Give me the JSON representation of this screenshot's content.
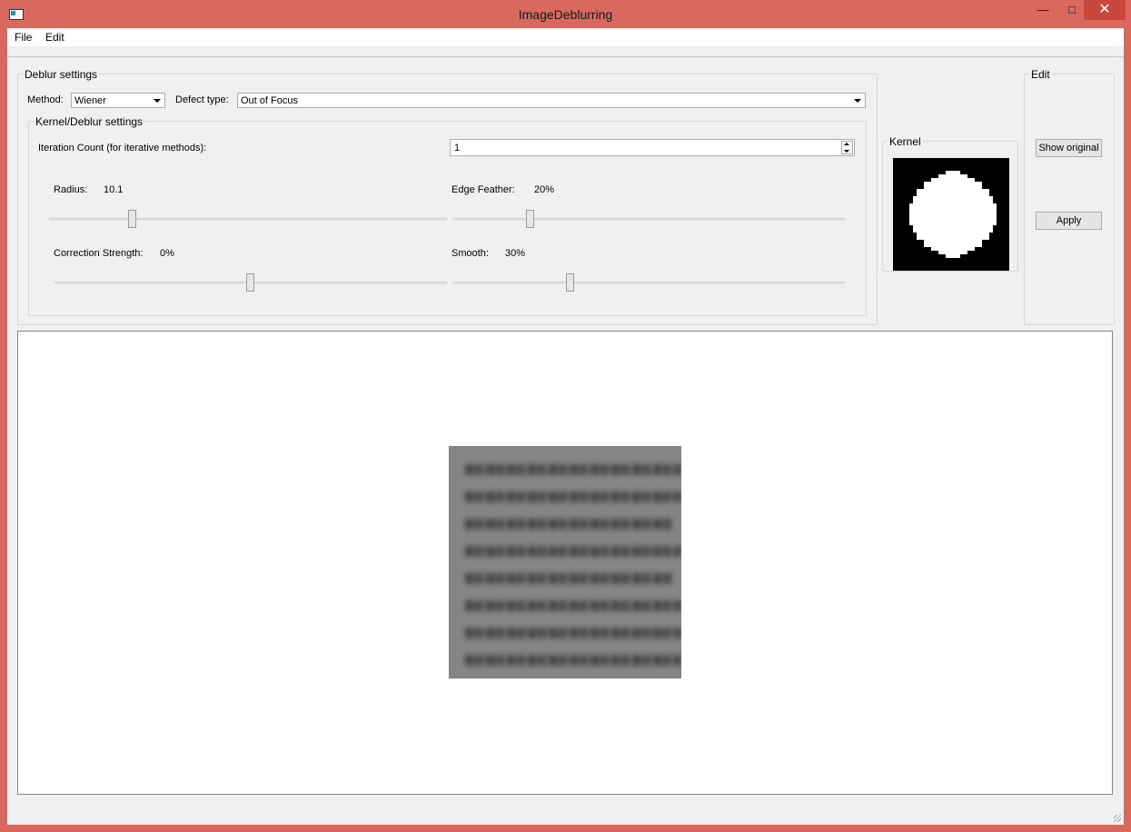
{
  "window": {
    "title": "ImageDeblurring",
    "minimize": "—",
    "maximize": "□",
    "close": "✕"
  },
  "menu": {
    "file": "File",
    "edit": "Edit"
  },
  "deblur_settings": {
    "title": "Deblur settings",
    "method_label": "Method:",
    "method_value": "Wiener",
    "defect_label": "Defect type:",
    "defect_value": "Out of Focus"
  },
  "kernel_settings": {
    "title": "Kernel/Deblur settings",
    "iteration_label": "Iteration Count (for iterative methods):",
    "iteration_value": "1",
    "radius_label": "Radius:",
    "radius_value": "10.1",
    "radius_slider_fraction": 0.21,
    "edge_label": "Edge Feather:",
    "edge_value": "20%",
    "edge_slider_fraction": 0.2,
    "correction_label": "Correction Strength:",
    "correction_value": "0%",
    "correction_slider_fraction": 0.5,
    "smooth_label": "Smooth:",
    "smooth_value": "30%",
    "smooth_slider_fraction": 0.3
  },
  "kernel_panel": {
    "title": "Kernel"
  },
  "edit_panel": {
    "title": "Edit",
    "show_original": "Show original",
    "apply": "Apply"
  },
  "colors": {
    "title_bar": "#d9685f",
    "window_bg": "#f0f0f0",
    "kernel_bg": "#000000",
    "kernel_fg": "#ffffff"
  }
}
